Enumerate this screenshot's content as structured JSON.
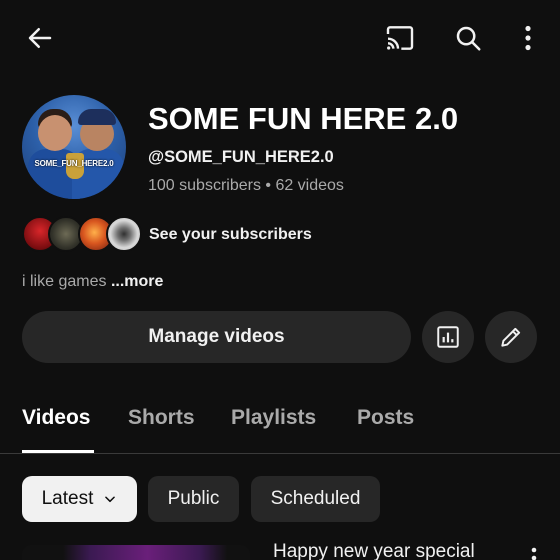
{
  "topbar": {
    "icons": [
      "back-arrow-icon",
      "cast-icon",
      "search-icon",
      "more-vert-icon"
    ]
  },
  "channel": {
    "title": "SOME FUN HERE 2.0",
    "handle": "@SOME_FUN_HERE2.0",
    "meta": "100 subscribers • 62 videos",
    "avatar_text": "SOME_FUN_HERE2.0",
    "see_subscribers_label": "See your subscribers",
    "description": "i like games",
    "more_label": "...more"
  },
  "actions": {
    "manage_videos_label": "Manage videos",
    "analytics_icon": "analytics-icon",
    "edit_icon": "edit-pencil-icon"
  },
  "tabs": [
    {
      "label": "Videos",
      "active": true
    },
    {
      "label": "Shorts",
      "active": false
    },
    {
      "label": "Playlists",
      "active": false
    },
    {
      "label": "Posts",
      "active": false
    }
  ],
  "filters": {
    "latest_label": "Latest",
    "public_label": "Public",
    "scheduled_label": "Scheduled"
  },
  "videos": [
    {
      "title": "Happy new year special"
    }
  ],
  "colors": {
    "background": "#0f0f0f",
    "surface": "#272727",
    "text_primary": "#f1f1f1",
    "text_secondary": "#aaaaaa",
    "selected_chip": "#f1f1f1"
  }
}
